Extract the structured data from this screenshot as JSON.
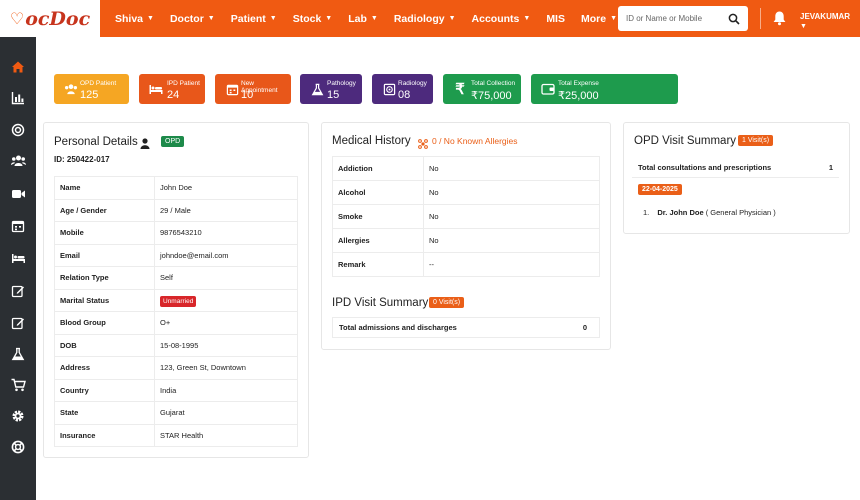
{
  "brand": {
    "logo_text": "DocDoc"
  },
  "nav": {
    "items": [
      {
        "label": "Shiva",
        "caret": true
      },
      {
        "label": "Doctor",
        "caret": true
      },
      {
        "label": "Patient",
        "caret": true
      },
      {
        "label": "Stock",
        "caret": true
      },
      {
        "label": "Lab",
        "caret": true
      },
      {
        "label": "Radiology",
        "caret": true
      },
      {
        "label": "Accounts",
        "caret": true
      },
      {
        "label": "MIS",
        "caret": false
      },
      {
        "label": "More",
        "caret": true
      }
    ],
    "search_placeholder": "ID or Name or Mobile",
    "user": "JEVAKUMAR"
  },
  "sidebar": {
    "icons": [
      "home-icon",
      "bar-chart-icon",
      "target-icon",
      "users-icon",
      "video-icon",
      "calendar-icon",
      "bed-icon",
      "edit-icon",
      "edit-alt-icon",
      "flask-icon",
      "cart-icon",
      "gear-icon",
      "lifebuoy-icon"
    ],
    "active": "home-icon",
    "accent": "#f05a12"
  },
  "stats": [
    {
      "label": "OPD Patient",
      "value": "125",
      "color": "#f5a623",
      "icon": "users-icon"
    },
    {
      "label": "IPD Patient",
      "value": "24",
      "color": "#e8571a",
      "icon": "bed-icon"
    },
    {
      "label": "New Appointment",
      "value": "10",
      "color": "#e8571a",
      "icon": "calendar-icon"
    },
    {
      "label": "Pathology",
      "value": "15",
      "color": "#4d2a7d",
      "icon": "flask-icon"
    },
    {
      "label": "Radiology",
      "value": "08",
      "color": "#4d2a7d",
      "icon": "radiology-icon"
    },
    {
      "label": "Total Collection",
      "value": "₹75,000",
      "color": "#1e9b4d",
      "icon": "rupee-icon"
    },
    {
      "label": "Total Expense",
      "value": "₹25,000",
      "color": "#1e9b4d",
      "icon": "wallet-icon"
    }
  ],
  "personal": {
    "title": "Personal Details",
    "badge": "OPD",
    "id_line": "ID: 250422-017",
    "rows": [
      {
        "key": "Name",
        "value": "John Doe"
      },
      {
        "key": "Age / Gender",
        "value": "29 / Male"
      },
      {
        "key": "Mobile",
        "value": "9876543210"
      },
      {
        "key": "Email",
        "value": "johndoe@email.com"
      },
      {
        "key": "Relation Type",
        "value": "Self"
      },
      {
        "key": "Marital Status",
        "value": "Unmarried",
        "badge": true
      },
      {
        "key": "Blood Group",
        "value": "O+"
      },
      {
        "key": "DOB",
        "value": "15-08-1995"
      },
      {
        "key": "Address",
        "value": "123, Green St, Downtown"
      },
      {
        "key": "Country",
        "value": "India"
      },
      {
        "key": "State",
        "value": "Gujarat"
      },
      {
        "key": "Insurance",
        "value": "STAR Health"
      }
    ]
  },
  "medical": {
    "title": "Medical History",
    "allergy_text": "0 / No Known Allergies",
    "rows": [
      {
        "key": "Addiction",
        "value": "No"
      },
      {
        "key": "Alcohol",
        "value": "No"
      },
      {
        "key": "Smoke",
        "value": "No"
      },
      {
        "key": "Allergies",
        "value": "No"
      },
      {
        "key": "Remark",
        "value": "--"
      }
    ]
  },
  "ipd": {
    "title": "IPD Visit Summary",
    "badge": "0 Visit(s)",
    "row_label": "Total admissions and discharges",
    "row_value": "0"
  },
  "opd": {
    "title": "OPD Visit Summary",
    "badge": "1 Visit(s)",
    "row_label": "Total consultations and prescriptions",
    "row_value": "1",
    "date": "22-04-2025",
    "entry_num": "1.",
    "doctor": "Dr. John Doe",
    "role": "( General Physician )"
  }
}
